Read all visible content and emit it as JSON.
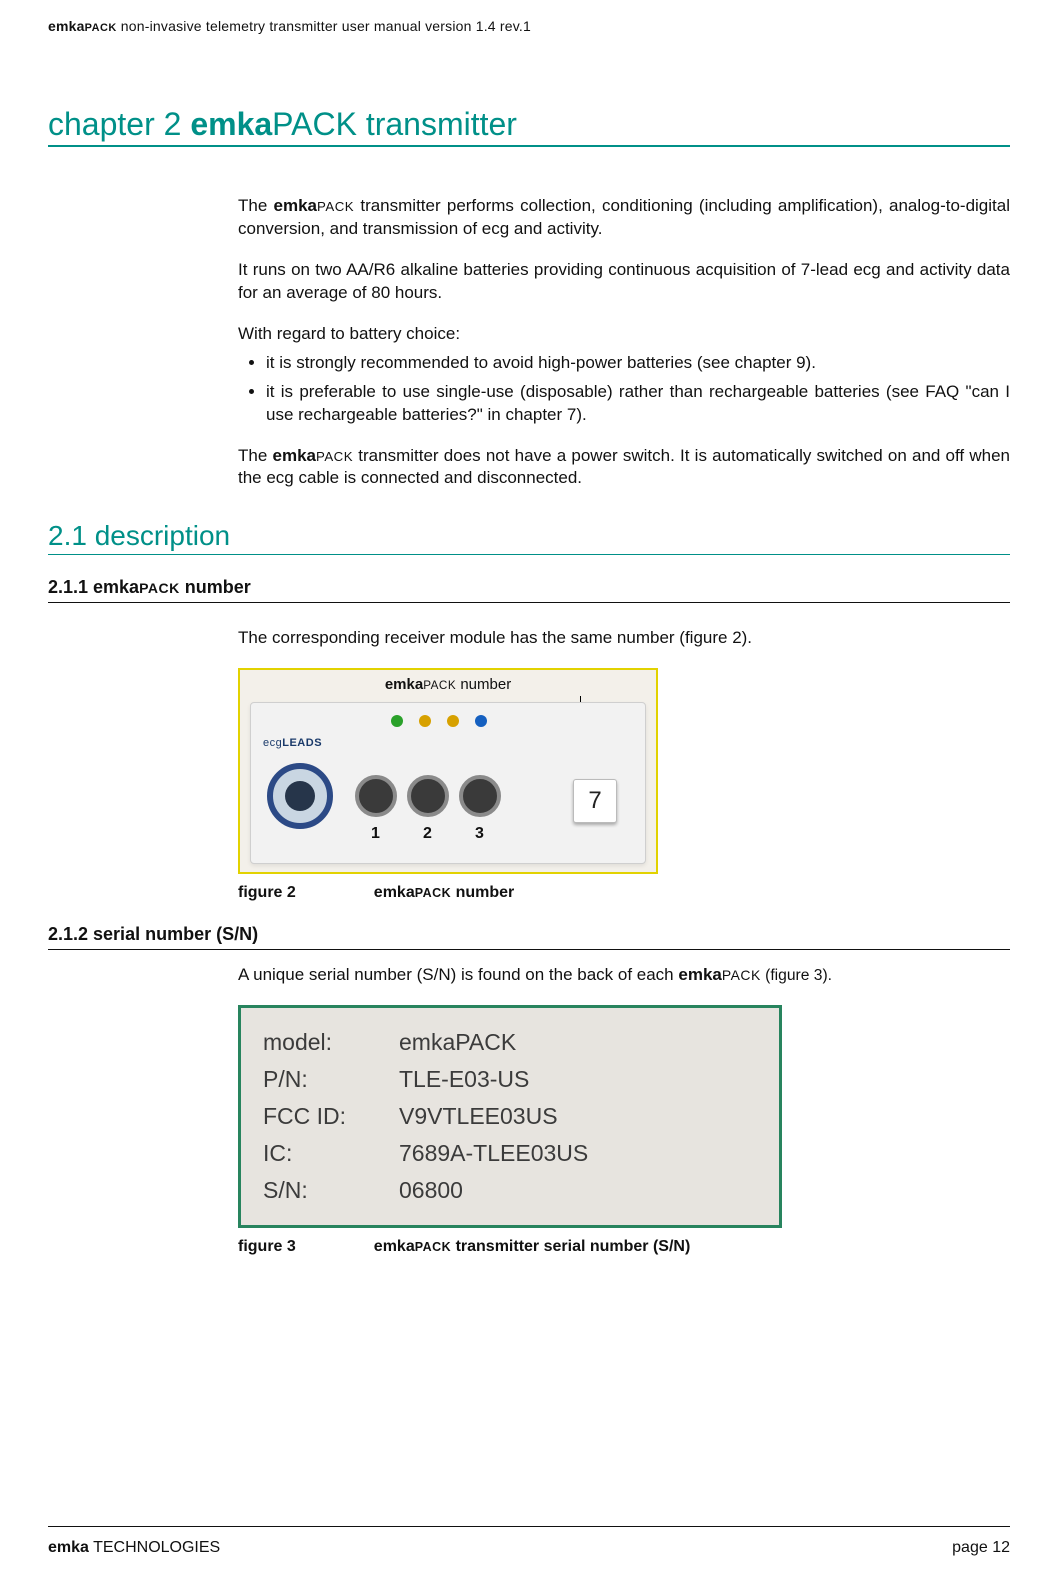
{
  "header": {
    "brand_bold": "emka",
    "brand_sc": "PACK",
    "rest": " non-invasive telemetry transmitter user manual version 1.4 rev.1"
  },
  "chapter": {
    "prefix": "chapter 2 ",
    "brand_bold": "emka",
    "brand_light": "PACK",
    "suffix": " transmitter"
  },
  "intro": {
    "p1_a": "The ",
    "p1_brand_b": "emka",
    "p1_brand_sc": "PACK",
    "p1_b": " transmitter performs collection, conditioning (including amplification), analog-to-digital conversion, and transmission of ecg and activity.",
    "p2": "It runs on two AA/R6 alkaline batteries providing continuous acquisition of 7-lead ecg and activity data for an average of 80 hours.",
    "p3": "With regard to battery choice:",
    "b1": "it is strongly recommended to avoid high-power batteries  (see chapter 9).",
    "b2": "it is preferable to use single-use (disposable) rather than rechargeable batteries (see FAQ \"can I use rechargeable batteries?\" in chapter 7).",
    "p4_a": "The ",
    "p4_brand_b": "emka",
    "p4_brand_sc": "PACK",
    "p4_b": " transmitter does not have a power switch. It is automatically switched on and off when the ecg cable is connected and disconnected."
  },
  "s21": {
    "title": "2.1 description"
  },
  "s211": {
    "title_a": "2.1.1 emka",
    "title_sc": "PACK",
    "title_b": " number",
    "p1": "The corresponding receiver module has the same number (figure 2).",
    "callout_b": "emka",
    "callout_sc": "PACK",
    "callout_rest": " number",
    "leads_a": "ecg",
    "leads_b": "LEADS",
    "port1": "1",
    "port2": "2",
    "port3": "3",
    "device_number": "7",
    "caption_a": "figure 2",
    "caption_b_bold": "emka",
    "caption_b_sc": "PACK",
    "caption_b_rest": " number"
  },
  "s212": {
    "title": "2.1.2 serial number (S/N)",
    "p1_a": "A unique serial number (S/N) is found on the back of each ",
    "p1_brand_b": "emka",
    "p1_brand_sc": "PACK",
    "p1_b": " (figure 3).",
    "rows": {
      "r0k": "model:",
      "r0v": "emkaPACK",
      "r1k": "P/N:",
      "r1v": "TLE-E03-US",
      "r2k": "FCC ID:",
      "r2v": "V9VTLEE03US",
      "r3k": "IC:",
      "r3v": "7689A-TLEE03US",
      "r4k": "S/N:",
      "r4v": "06800"
    },
    "caption_a": "figure 3",
    "caption_b_bold": "emka",
    "caption_b_sc": "PACK",
    "caption_b_rest": " transmitter serial number (S/N)"
  },
  "footer": {
    "brand_b": "emka",
    "brand_rest": " TECHNOLOGIES",
    "page": "page 12"
  }
}
